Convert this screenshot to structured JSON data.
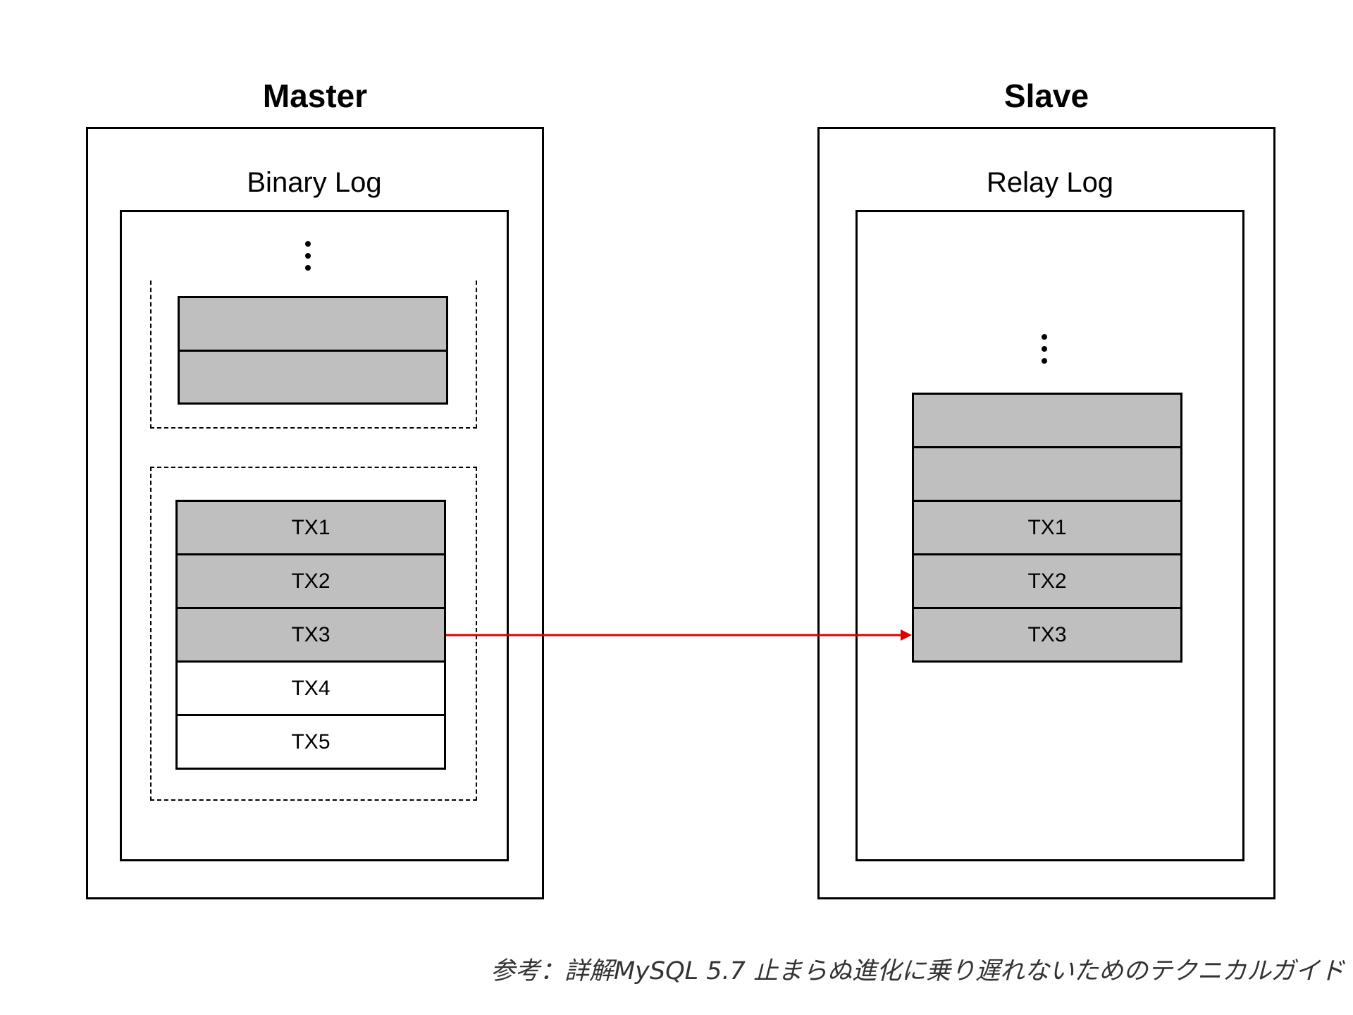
{
  "master": {
    "title": "Master",
    "log_title": "Binary Log",
    "top_group_cells": [
      "",
      ""
    ],
    "tx_group_cells": [
      {
        "label": "TX1",
        "shaded": true
      },
      {
        "label": "TX2",
        "shaded": true
      },
      {
        "label": "TX3",
        "shaded": true
      },
      {
        "label": "TX4",
        "shaded": false
      },
      {
        "label": "TX5",
        "shaded": false
      }
    ]
  },
  "slave": {
    "title": "Slave",
    "log_title": "Relay Log",
    "cells": [
      {
        "label": "",
        "shaded": true
      },
      {
        "label": "",
        "shaded": true
      },
      {
        "label": "TX1",
        "shaded": true
      },
      {
        "label": "TX2",
        "shaded": true
      },
      {
        "label": "TX3",
        "shaded": true
      }
    ]
  },
  "arrow": {
    "color": "#e00000"
  },
  "colors": {
    "shaded_cell": "#bfbfbf",
    "border": "#000000"
  },
  "caption": "参考：詳解MySQL 5.7 止まらぬ進化に乗り遅れないためのテクニカルガイド"
}
